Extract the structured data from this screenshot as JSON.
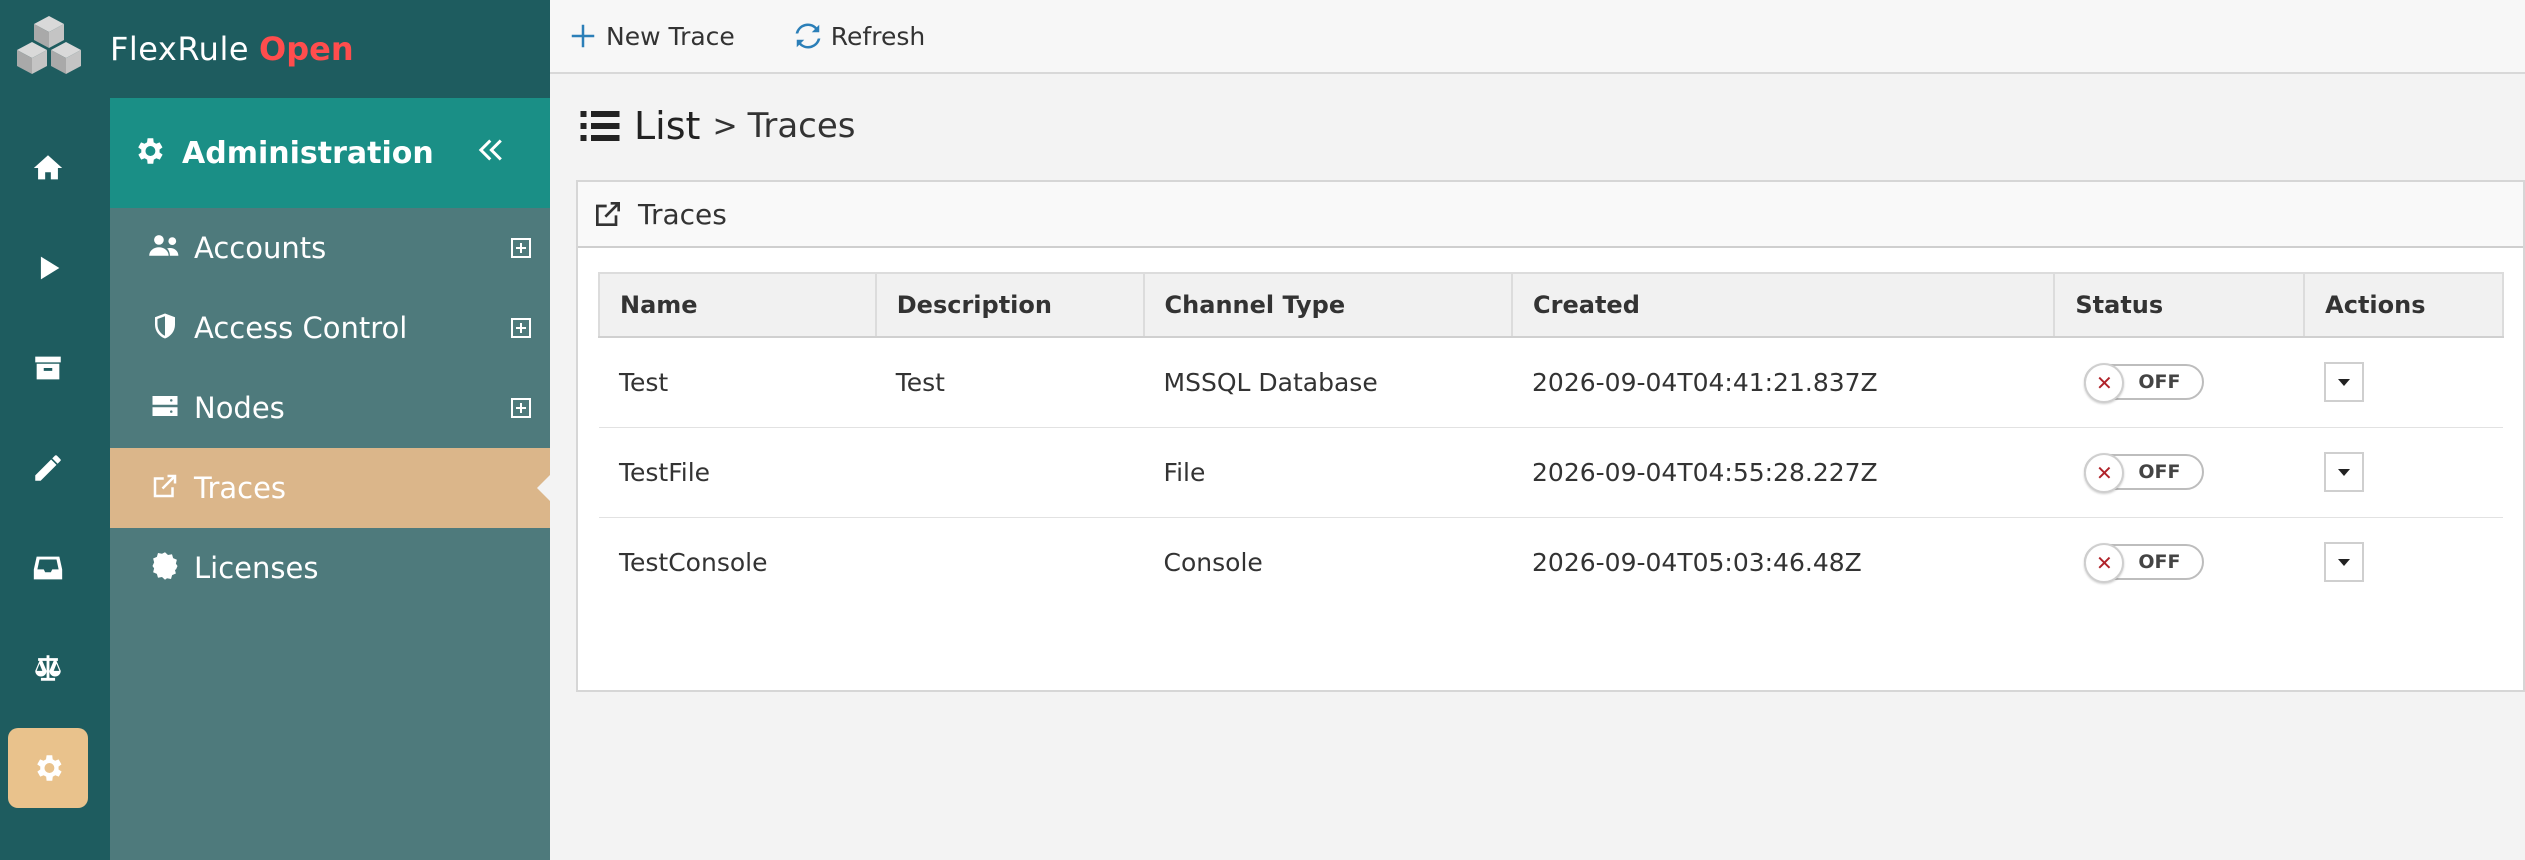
{
  "brand": {
    "name": "FlexRule",
    "highlight": "Open"
  },
  "rail": {
    "items": [
      {
        "icon": "home-icon"
      },
      {
        "icon": "play-icon"
      },
      {
        "icon": "archive-icon"
      },
      {
        "icon": "pencil-icon"
      },
      {
        "icon": "inbox-icon"
      },
      {
        "icon": "scale-icon"
      },
      {
        "icon": "gear-icon",
        "active": true
      }
    ]
  },
  "sidebar": {
    "title": "Administration",
    "items": [
      {
        "label": "Accounts",
        "icon": "users-icon",
        "expandable": true
      },
      {
        "label": "Access Control",
        "icon": "shield-icon",
        "expandable": true
      },
      {
        "label": "Nodes",
        "icon": "server-icon",
        "expandable": true
      },
      {
        "label": "Traces",
        "icon": "external-link-icon",
        "active": true
      },
      {
        "label": "Licenses",
        "icon": "certificate-icon"
      }
    ]
  },
  "toolbar": {
    "new_label": "New Trace",
    "refresh_label": "Refresh"
  },
  "breadcrumb": {
    "root": "List",
    "separator": ">",
    "current": "Traces"
  },
  "panel": {
    "title": "Traces"
  },
  "table": {
    "columns": [
      "Name",
      "Description",
      "Channel Type",
      "Created",
      "Status",
      "Actions"
    ],
    "rows": [
      {
        "name": "Test",
        "description": "Test",
        "channel": "MSSQL Database",
        "created": "2026-09-04T04:41:21.837Z",
        "status": "OFF"
      },
      {
        "name": "TestFile",
        "description": "",
        "channel": "File",
        "created": "2026-09-04T04:55:28.227Z",
        "status": "OFF"
      },
      {
        "name": "TestConsole",
        "description": "",
        "channel": "Console",
        "created": "2026-09-04T05:03:46.48Z",
        "status": "OFF"
      }
    ]
  },
  "colors": {
    "rail": "#1e5c5f",
    "sidebar": "#4e7a7c",
    "sidebar_head": "#1a8f86",
    "active_item": "#dbb68a",
    "brand_highlight": "#ff4d4d",
    "accent": "#2b7fb8"
  }
}
